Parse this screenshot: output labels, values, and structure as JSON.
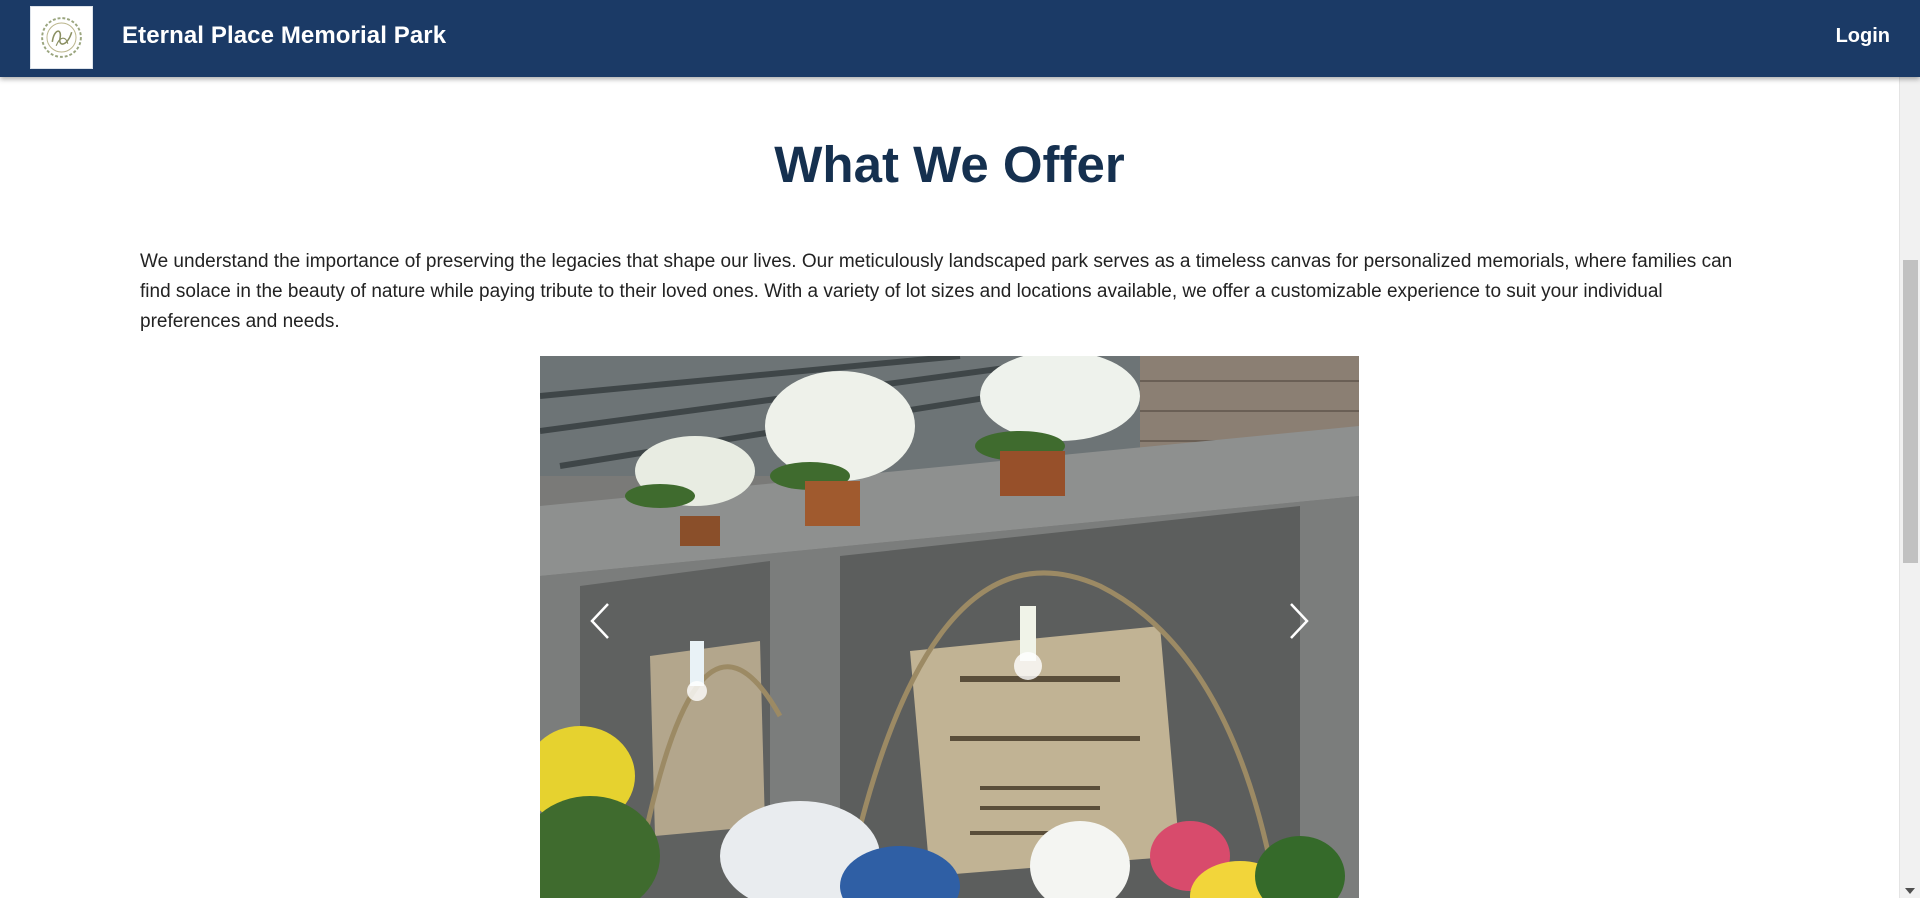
{
  "header": {
    "site_title": "Eternal Place Memorial Park",
    "login_label": "Login",
    "background_color": "#1b3a66"
  },
  "main": {
    "section_title": "What We Offer",
    "intro_text": "We understand the importance of preserving the legacies that shape our lives. Our meticulously landscaped park serves as a timeless canvas for personalized memorials, where families can find solace in the beauty of nature while paying tribute to their loved ones. With a variety of lot sizes and locations available, we offer a customizable experience to suit your individual preferences and needs.",
    "title_color": "#15304f"
  },
  "carousel": {
    "prev_icon": "chevron-left-icon",
    "next_icon": "chevron-right-icon"
  }
}
